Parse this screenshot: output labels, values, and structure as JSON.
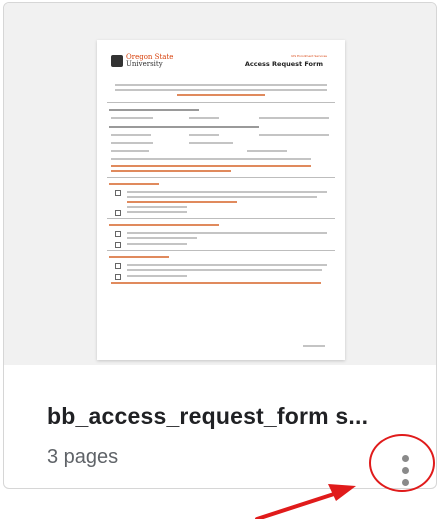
{
  "card": {
    "title": "bb_access_request_form s...",
    "subtitle": "3 pages",
    "menu_icon": "more-vertical-icon"
  },
  "thumbnail": {
    "logo_top": "Oregon State",
    "logo_bottom": "University",
    "department": "UIS Enrollment Services",
    "form_title": "Access Request Form"
  },
  "annotation": {
    "color": "#e01b1b",
    "marks": [
      "red-circle",
      "red-arrow"
    ]
  }
}
